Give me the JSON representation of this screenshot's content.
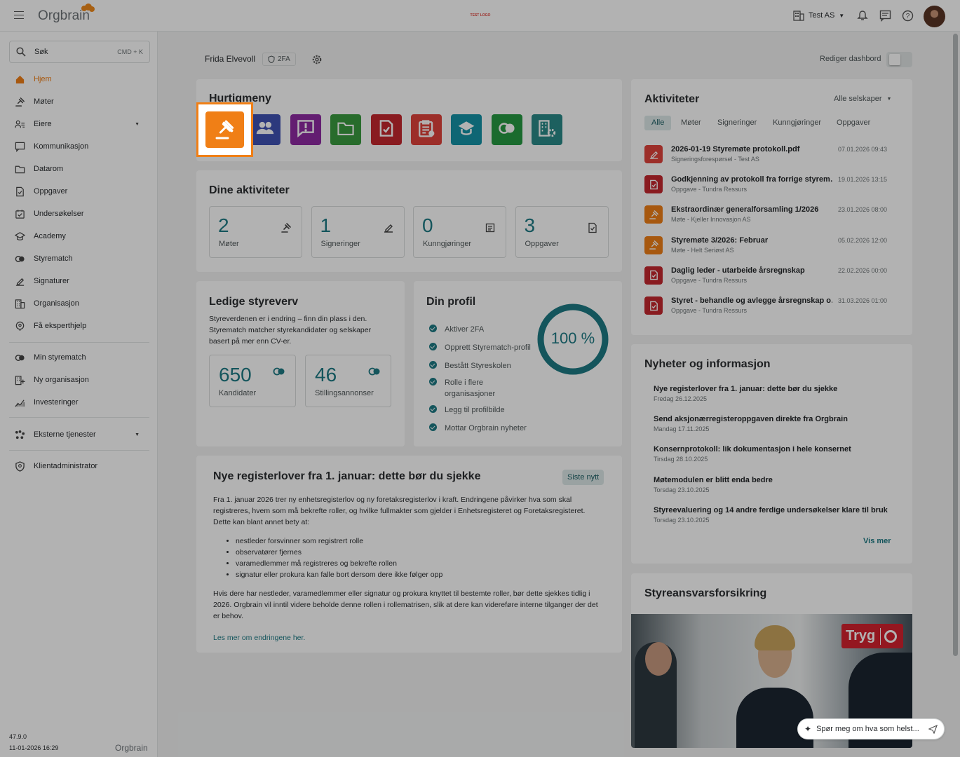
{
  "header": {
    "logo": "Orgbrain",
    "center_logo": "TEST LOGO",
    "company": "Test AS"
  },
  "search": {
    "label": "Søk",
    "shortcut": "CMD + K"
  },
  "sidebar": {
    "items": [
      {
        "label": "Hjem",
        "icon": "home-icon"
      },
      {
        "label": "Møter",
        "icon": "gavel-icon"
      },
      {
        "label": "Eiere",
        "icon": "owners-icon"
      },
      {
        "label": "Kommunikasjon",
        "icon": "chat-icon"
      },
      {
        "label": "Datarom",
        "icon": "folder-icon"
      },
      {
        "label": "Oppgaver",
        "icon": "task-icon"
      },
      {
        "label": "Undersøkelser",
        "icon": "survey-icon"
      },
      {
        "label": "Academy",
        "icon": "academy-icon"
      },
      {
        "label": "Styrematch",
        "icon": "rings-icon"
      },
      {
        "label": "Signaturer",
        "icon": "signature-icon"
      },
      {
        "label": "Organisasjon",
        "icon": "building-icon"
      },
      {
        "label": "Få eksperthjelp",
        "icon": "expert-icon"
      }
    ],
    "items2": [
      {
        "label": "Min styrematch",
        "icon": "rings-icon"
      },
      {
        "label": "Ny organisasjon",
        "icon": "new-org-icon"
      },
      {
        "label": "Investeringer",
        "icon": "chart-icon"
      }
    ],
    "external": "Eksterne tjenester",
    "admin": "Klientadministrator",
    "version": "47.9.0",
    "date": "11-01-2026 16:29",
    "footer_logo": "Orgbrain"
  },
  "user": {
    "name": "Frida Elvevoll",
    "badge": "2FA"
  },
  "edit_dashboard": "Rediger dashbord",
  "quickmenu": {
    "title": "Hurtigmeny",
    "items": [
      {
        "icon": "gavel-icon",
        "color": "#f07f16"
      },
      {
        "icon": "people-icon",
        "color": "#3f52b4"
      },
      {
        "icon": "alert-chat-icon",
        "color": "#8e2aa3"
      },
      {
        "icon": "folder-icon",
        "color": "#3a9b3f"
      },
      {
        "icon": "task-doc-icon",
        "color": "#c4282e"
      },
      {
        "icon": "clipboard-icon",
        "color": "#e0433c"
      },
      {
        "icon": "school-icon",
        "color": "#1592a6"
      },
      {
        "icon": "rings-icon",
        "color": "#269a43"
      },
      {
        "icon": "building-gear-icon",
        "color": "#2a8a88"
      }
    ]
  },
  "activities": {
    "title": "Dine aktiviteter",
    "stats": [
      {
        "value": "2",
        "label": "Møter"
      },
      {
        "value": "1",
        "label": "Signeringer"
      },
      {
        "value": "0",
        "label": "Kunngjøringer"
      },
      {
        "value": "3",
        "label": "Oppgaver"
      }
    ]
  },
  "vacancies": {
    "title": "Ledige styreverv",
    "text": "Styreverdenen er i endring – finn din plass i den. Styrematch matcher styrekandidater og selskaper basert på mer enn CV-er.",
    "candidates_value": "650",
    "candidates_label": "Kandidater",
    "ads_value": "46",
    "ads_label": "Stillingsannonser"
  },
  "profile": {
    "title": "Din profil",
    "percent": "100 %",
    "progress": 1.0,
    "items": [
      "Aktiver 2FA",
      "Opprett Styrematch-profil",
      "Bestått Styreskolen",
      "Rolle i flere organisasjoner",
      "Legg til profilbilde",
      "Mottar Orgbrain nyheter"
    ]
  },
  "article": {
    "title": "Nye registerlover fra 1. januar: dette bør du sjekke",
    "tag": "Siste nytt",
    "p1": "Fra 1. januar 2026 trer ny enhetsregisterlov og ny foretaksregisterlov i kraft. Endringene påvirker hva som skal registreres, hvem som må bekrefte roller, og hvilke fullmakter som gjelder i Enhetsregisteret og Foretaksregisteret. Dette kan blant annet bety at:",
    "bullets": [
      "nestleder forsvinner som registrert rolle",
      "observatører fjernes",
      "varamedlemmer må registreres og bekrefte rollen",
      "signatur eller prokura kan falle bort dersom dere ikke følger opp"
    ],
    "p2": "Hvis dere har nestleder, varamedlemmer eller signatur og prokura knyttet til bestemte roller, bør dette sjekkes tidlig i 2026. Orgbrain vil inntil videre beholde denne rollen i rollematrisen, slik at dere kan videreføre interne tilganger der det er behov.",
    "link": "Les mer om endringene her."
  },
  "feed": {
    "title": "Aktiviteter",
    "filter": "Alle selskaper",
    "tabs": [
      "Alle",
      "Møter",
      "Signeringer",
      "Kunngjøringer",
      "Oppgaver"
    ],
    "items": [
      {
        "title": "2026-01-19 Styremøte protokoll.pdf",
        "sub": "Signeringsforespørsel - Test AS",
        "date": "07.01.2026 09:43",
        "icon": "signature-icon",
        "color": "#e0433c"
      },
      {
        "title": "Godkjenning av protokoll fra forrige styrem…",
        "sub": "Oppgave - Tundra Ressurs",
        "date": "19.01.2026 13:15",
        "icon": "task-doc-icon",
        "color": "#c4282e"
      },
      {
        "title": "Ekstraordinær generalforsamling 1/2026",
        "sub": "Møte - Kjeller Innovasjon AS",
        "date": "23.01.2026 08:00",
        "icon": "gavel-icon",
        "color": "#f07f16"
      },
      {
        "title": "Styremøte 3/2026: Februar",
        "sub": "Møte - Helt Seriøst AS",
        "date": "05.02.2026 12:00",
        "icon": "gavel-icon",
        "color": "#f07f16"
      },
      {
        "title": "Daglig leder - utarbeide årsregnskap",
        "sub": "Oppgave - Tundra Ressurs",
        "date": "22.02.2026 00:00",
        "icon": "task-doc-icon",
        "color": "#c4282e"
      },
      {
        "title": "Styret - behandle og avlegge årsregnskap o…",
        "sub": "Oppgave - Tundra Ressurs",
        "date": "31.03.2026 01:00",
        "icon": "task-doc-icon",
        "color": "#c4282e"
      }
    ]
  },
  "news": {
    "title": "Nyheter og informasjon",
    "more": "Vis mer",
    "items": [
      {
        "title": "Nye registerlover fra 1. januar: dette bør du sjekke",
        "date": "Fredag 26.12.2025"
      },
      {
        "title": "Send aksjonærregisteroppgaven direkte fra Orgbrain",
        "date": "Mandag 17.11.2025"
      },
      {
        "title": "Konsernprotokoll: lik dokumentasjon i hele konsernet",
        "date": "Tirsdag 28.10.2025"
      },
      {
        "title": "Møtemodulen er blitt enda bedre",
        "date": "Torsdag 23.10.2025"
      },
      {
        "title": "Styreevaluering og 14 andre ferdige undersøkelser klare til bruk",
        "date": "Torsdag 23.10.2025"
      }
    ]
  },
  "insurance": {
    "title": "Styreansvarsforsikring",
    "brand": "Tryg"
  },
  "assistant": {
    "placeholder": "Spør meg om hva som helst..."
  }
}
